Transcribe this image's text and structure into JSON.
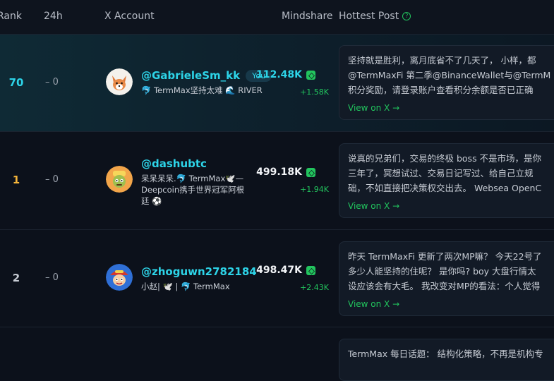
{
  "header": {
    "rank": "Rank",
    "h24": "24h",
    "account": "X Account",
    "mindshare": "Mindshare",
    "hottest": "Hottest Post",
    "hottest_icon": "question-circle-icon"
  },
  "rows": [
    {
      "rank": "70",
      "change": "– 0",
      "handle": "@GabrieleSm_kk",
      "badge": "You",
      "bio": "🐬 TermMax坚持太难 🌊 RIVER",
      "mindshare": "112.48K",
      "delta": "+1.58K",
      "post_lines": [
        "坚持就是胜利，离月底省不了几天了， 小样，都",
        "@TermMaxFi 第二季@BinanceWallet与@TermM",
        "积分奖励，请登录账户查看积分余额是否已正确"
      ],
      "view": "View on X →"
    },
    {
      "rank": "1",
      "change": "– 0",
      "handle": "@dashubtc",
      "bio_lines": [
        "呆呆呆呆.🐬 TermMax🕊️—",
        "Deepcoin携手世界冠军阿根",
        "廷 ⚽"
      ],
      "mindshare": "499.18K",
      "delta": "+1.94K",
      "post_lines": [
        "说真的兄弟们，交易的终极 boss 不是市场，是你",
        "三年了，冥想试过、交易日记写过、给自己立规",
        "础，不如直接把决策权交出去。 Websea OpenC"
      ],
      "view": "View on X →"
    },
    {
      "rank": "2",
      "change": "– 0",
      "handle": "@zhoguwn2782184",
      "bio": "小赵| 🕊️ | 🐬 TermMax",
      "mindshare": "498.47K",
      "delta": "+2.43K",
      "post_lines": [
        "昨天 TermMaxFi 更新了两次MP嘛？ 今天22号了",
        "多少人能坚持的住呢？ 是你吗? boy 大盘行情太",
        "设应该会有大毛。 我改变对MP的看法：个人觉得"
      ],
      "view": "View on X →"
    },
    {
      "post_lines": [
        "TermMax 每日话题： 结构化策略，不再是机构专"
      ]
    }
  ]
}
